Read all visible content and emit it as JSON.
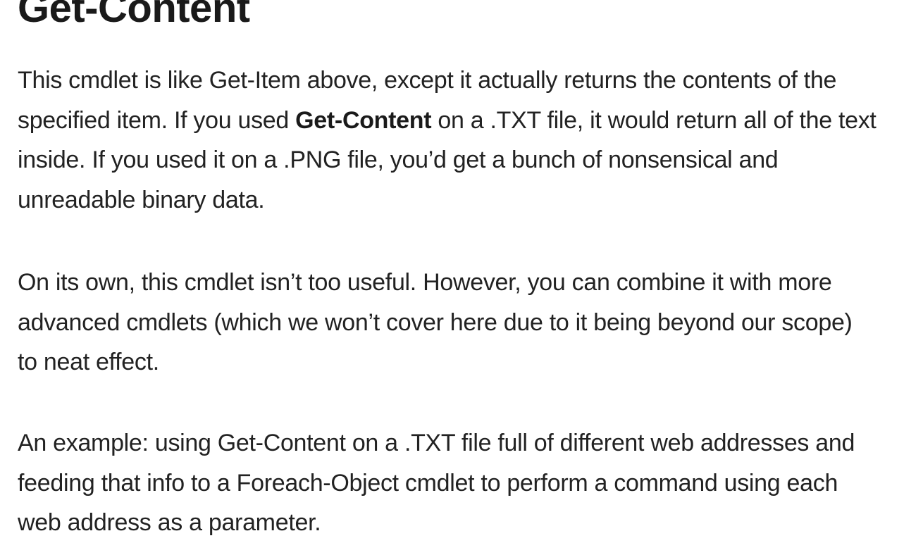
{
  "article": {
    "heading": "Get-Content",
    "paragraphs": [
      {
        "lines": [
          {
            "text": "This cmdlet is like Get-Item above, except it actually returns the contents of the"
          },
          {
            "before": "specified item. If you used ",
            "bold": "Get-Content",
            "after": " on a .TXT file, it would return all of the text"
          },
          {
            "text": "inside. If you used it on a .PNG file, you’d get a bunch of nonsensical and"
          },
          {
            "text": "unreadable binary data."
          }
        ]
      },
      {
        "lines": [
          {
            "text": "On its own, this cmdlet isn’t too useful. However, you can combine it with more"
          },
          {
            "text": "advanced cmdlets (which we won’t cover here due to it being beyond our scope)"
          },
          {
            "text": "to neat effect."
          }
        ]
      },
      {
        "lines": [
          {
            "text": "An example: using Get-Content on a .TXT file full of different web addresses and"
          },
          {
            "text": "feeding that info to a Foreach-Object cmdlet to perform a command using each"
          },
          {
            "text": "web address as a parameter."
          }
        ]
      }
    ]
  }
}
